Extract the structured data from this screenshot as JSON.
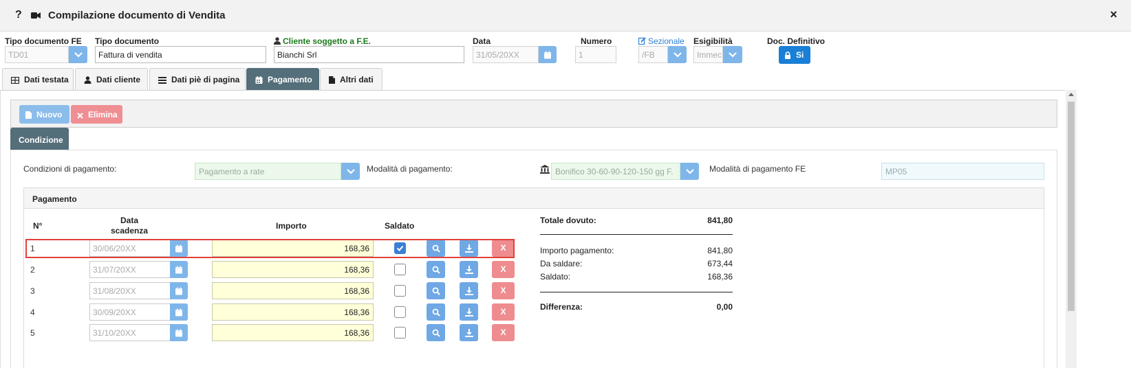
{
  "window": {
    "help_label": "?",
    "title": "Compilazione documento di Vendita",
    "close_label": "×"
  },
  "header": {
    "tipo_doc_fe": {
      "label": "Tipo documento FE",
      "value": "TD01"
    },
    "tipo_doc": {
      "label": "Tipo documento",
      "value": "Fattura di vendita"
    },
    "cliente": {
      "label": "Cliente soggetto a F.E.",
      "value": "Bianchi Srl"
    },
    "data": {
      "label": "Data",
      "value": "31/05/20XX"
    },
    "numero": {
      "label": "Numero",
      "value": "1"
    },
    "sezionale": {
      "label": "Sezionale",
      "value": "/FB"
    },
    "esigibilita": {
      "label": "Esigibilità",
      "value": "Immec"
    },
    "doc_definitivo": {
      "label": "Doc. Definitivo",
      "button": "Si"
    }
  },
  "tabs": [
    {
      "label": "Dati testata",
      "icon": "table-icon"
    },
    {
      "label": "Dati cliente",
      "icon": "user-icon"
    },
    {
      "label": "Dati piè di pagina",
      "icon": "list-icon"
    },
    {
      "label": "Pagamento",
      "icon": "calendar-icon",
      "active": true
    },
    {
      "label": "Altri dati",
      "icon": "file-icon"
    }
  ],
  "toolbar": {
    "nuovo": "Nuovo",
    "elimina": "Elimina"
  },
  "subtab": "Condizione",
  "condizione": {
    "condizioni_label": "Condizioni di pagamento:",
    "condizioni_value": "Pagamento a rate",
    "modalita_label": "Modalità di pagamento:",
    "modalita_value": "Bonifico 30-60-90-120-150 gg F.",
    "modalita_fe_label": "Modalità di pagamento FE",
    "modalita_fe_value": "MP05"
  },
  "pagamento": {
    "title": "Pagamento",
    "columns": {
      "n": "N°",
      "data_line1": "Data",
      "data_line2": "scadenza",
      "importo": "Importo",
      "saldato": "Saldato"
    },
    "rows": [
      {
        "n": "1",
        "data": "30/06/20XX",
        "importo": "168,36",
        "saldato": true
      },
      {
        "n": "2",
        "data": "31/07/20XX",
        "importo": "168,36",
        "saldato": false
      },
      {
        "n": "3",
        "data": "31/08/20XX",
        "importo": "168,36",
        "saldato": false
      },
      {
        "n": "4",
        "data": "30/09/20XX",
        "importo": "168,36",
        "saldato": false
      },
      {
        "n": "5",
        "data": "31/10/20XX",
        "importo": "168,36",
        "saldato": false
      }
    ],
    "delete_label": "X"
  },
  "summary": {
    "totale_label": "Totale dovuto:",
    "totale_value": "841,80",
    "importo_label": "Importo pagamento:",
    "importo_value": "841,80",
    "da_saldare_label": "Da saldare:",
    "da_saldare_value": "673,44",
    "saldato_label": "Saldato:",
    "saldato_value": "168,36",
    "differenza_label": "Differenza:",
    "differenza_value": "0,00"
  },
  "colors": {
    "accent": "#7fb6ea",
    "active_tab": "#546e7a",
    "primary": "#1a7fd6",
    "danger": "#ee8c8f",
    "highlight": "#e0403a"
  }
}
